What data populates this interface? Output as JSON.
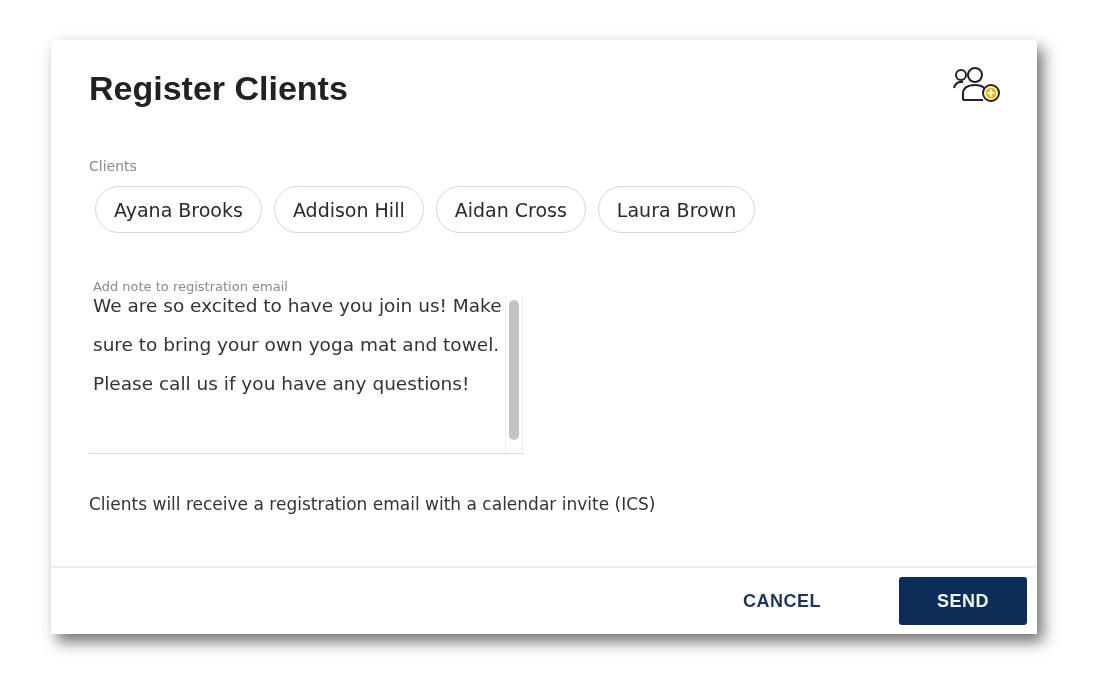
{
  "dialog": {
    "title": "Register Clients",
    "clients_label": "Clients",
    "clients": [
      {
        "name": "Ayana Brooks"
      },
      {
        "name": "Addison Hill"
      },
      {
        "name": "Aidan Cross"
      },
      {
        "name": "Laura Brown"
      }
    ],
    "note": {
      "label": "Add note to registration email",
      "value": "We are so excited to have you join us! Make sure to bring your own yoga mat and towel. Please call us if you have any questions!"
    },
    "info": "Clients will receive a registration email with a calendar invite (ICS)",
    "buttons": [
      {
        "label": "CANCEL",
        "kind": "text"
      },
      {
        "label": "SEND",
        "kind": "primary"
      }
    ]
  }
}
